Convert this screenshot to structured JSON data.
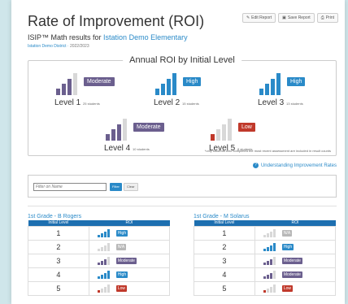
{
  "header": {
    "title": "Rate of Improvement (ROI)",
    "subtitle_prefix": "ISIP™ Math results for",
    "school": "Istation Demo Elementary",
    "district": "Istation Demo District",
    "year": "2022/2023",
    "buttons": [
      {
        "label": "Edit Report",
        "icon": "pencil-icon"
      },
      {
        "label": "Save Report",
        "icon": "save-icon"
      },
      {
        "label": "Print",
        "icon": "print-icon"
      }
    ]
  },
  "summary": {
    "title": "Annual ROI by Initial Level",
    "footnote": "*only students who completed the most recent assessment are included in result counts",
    "levels": [
      {
        "name": "Level 1",
        "count": "25 students",
        "rating": "Moderate",
        "color": "#6b5f8e",
        "filled": 3,
        "fill_color": "#6b5f8e"
      },
      {
        "name": "Level 2",
        "count": "15 students",
        "rating": "High",
        "color": "#2a8ac8",
        "filled": 4,
        "fill_color": "#2a8ac8"
      },
      {
        "name": "Level 3",
        "count": "13 students",
        "rating": "High",
        "color": "#2a8ac8",
        "filled": 4,
        "fill_color": "#2a8ac8"
      },
      {
        "name": "Level 4",
        "count": "10 students",
        "rating": "Moderate",
        "color": "#6b5f8e",
        "filled": 3,
        "fill_color": "#6b5f8e"
      },
      {
        "name": "Level 5",
        "count": "8 students",
        "rating": "Low",
        "color": "#c0392b",
        "filled": 1,
        "fill_color": "#c0392b"
      }
    ]
  },
  "help_link": "Understanding Improvement Rates",
  "filter": {
    "placeholder": "Filter on Name",
    "filter_label": "Filter",
    "clear_label": "Clear"
  },
  "classes": [
    {
      "title": "1st Grade - B Rogers",
      "headers": [
        "Initial Level",
        "ROI"
      ],
      "rows": [
        {
          "level": "1",
          "rating": "High",
          "color": "#2a8ac8",
          "filled": 4
        },
        {
          "level": "2",
          "rating": "N/A",
          "color": "#b8b8b8",
          "filled": 0
        },
        {
          "level": "3",
          "rating": "Moderate",
          "color": "#6b5f8e",
          "filled": 3
        },
        {
          "level": "4",
          "rating": "High",
          "color": "#2a8ac8",
          "filled": 4
        },
        {
          "level": "5",
          "rating": "Low",
          "color": "#c0392b",
          "filled": 1
        }
      ]
    },
    {
      "title": "1st Grade - M Solarus",
      "headers": [
        "Initial Level",
        "ROI"
      ],
      "rows": [
        {
          "level": "1",
          "rating": "N/A",
          "color": "#b8b8b8",
          "filled": 0
        },
        {
          "level": "2",
          "rating": "High",
          "color": "#2a8ac8",
          "filled": 4
        },
        {
          "level": "3",
          "rating": "Moderate",
          "color": "#6b5f8e",
          "filled": 3
        },
        {
          "level": "4",
          "rating": "Moderate",
          "color": "#6b5f8e",
          "filled": 3
        },
        {
          "level": "5",
          "rating": "Low",
          "color": "#c0392b",
          "filled": 1
        }
      ]
    }
  ]
}
